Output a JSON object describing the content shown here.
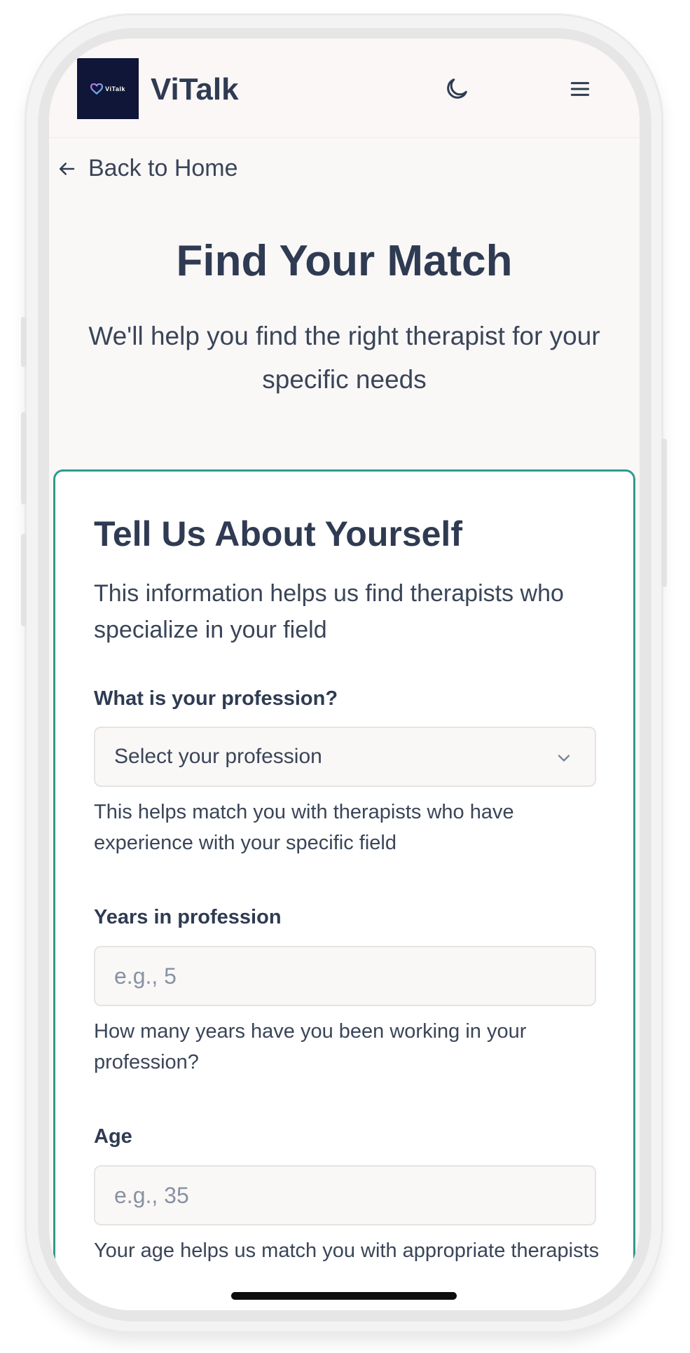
{
  "header": {
    "logo_text": "ViTalk",
    "brand": "ViTalk"
  },
  "nav": {
    "back_label": "Back to Home"
  },
  "hero": {
    "title": "Find Your Match",
    "subtitle": "We'll help you find the right therapist for your specific needs"
  },
  "form": {
    "title": "Tell Us About Yourself",
    "description": "This information helps us find therapists who specialize in your field",
    "profession": {
      "label": "What is your profession?",
      "selected": "Select your profession",
      "help": "This helps match you with therapists who have experience with your specific field"
    },
    "years": {
      "label": "Years in profession",
      "placeholder": "e.g., 5",
      "help": "How many years have you been working in your profession?"
    },
    "age": {
      "label": "Age",
      "placeholder": "e.g., 35",
      "help": "Your age helps us match you with appropriate therapists"
    }
  },
  "colors": {
    "accent": "#2f9b8b",
    "logo_bg": "#0f1638",
    "text_primary": "#2f3b52"
  },
  "icons": [
    "heart-logo-icon",
    "moon-icon",
    "hamburger-menu-icon",
    "arrow-left-icon",
    "chevron-down-icon"
  ]
}
